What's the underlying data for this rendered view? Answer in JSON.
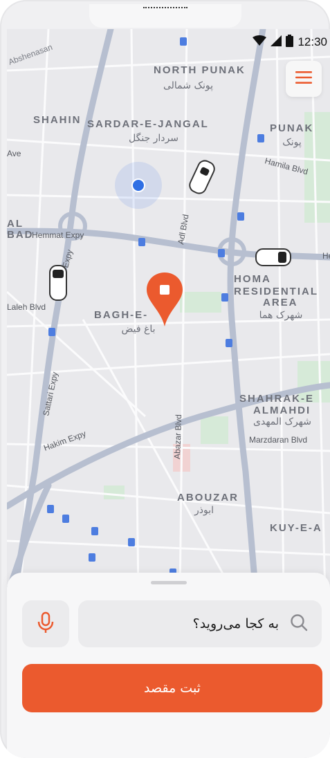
{
  "status_bar": {
    "time": "12:30"
  },
  "map": {
    "labels": {
      "north_punak": "NORTH PUNAK",
      "north_punak_fa": "پونک شمالی",
      "shahin": "SHAHIN",
      "sardar": "SARDAR-E-JANGAL",
      "sardar_fa": "سردار جنگل",
      "punak": "PUNAK",
      "punak_fa": "پونک",
      "hamila": "Hamila Blvd",
      "ave": "Ave",
      "al": "AL",
      "bad": "BAD",
      "hemmat": "Hemmat Expy",
      "adl": "Adl Blvd",
      "expy": "Expy",
      "homa1": "HOMA",
      "homa2": "RESIDENTIAL",
      "homa3": "AREA",
      "homa_fa": "شهرک هما",
      "laleh": "Laleh Blvd",
      "bagh": "BAGH-E-",
      "bagh_fa": "باغ فیض",
      "sattari": "Sattari Expy",
      "shahrak1": "SHAHRAK-E",
      "shahrak2": "ALMAHDI",
      "shahrak_fa": "شهرک المهدی",
      "marzdaran": "Marzdaran Blvd",
      "hakim": "Hakim Expy",
      "abazar": "Abazar Blvd",
      "abouzar": "ABOUZAR",
      "abouzar_fa": "ابوذر",
      "kuy": "KUY-E-A",
      "absh": "Abshenasan",
      "h": "He"
    },
    "colors": {
      "water_park": "#cfe8d3",
      "roads": "#ffffff",
      "highway": "#b9c2d4",
      "accent": "#eb5a2e",
      "location": "#2f6fe4"
    }
  },
  "search": {
    "placeholder": "به کجا می‌روید؟"
  },
  "cta": {
    "label": "ثبت مقصد"
  },
  "icons": {
    "mic": "mic-icon",
    "search": "search-icon",
    "menu": "menu-icon",
    "pin": "destination-pin-icon"
  }
}
